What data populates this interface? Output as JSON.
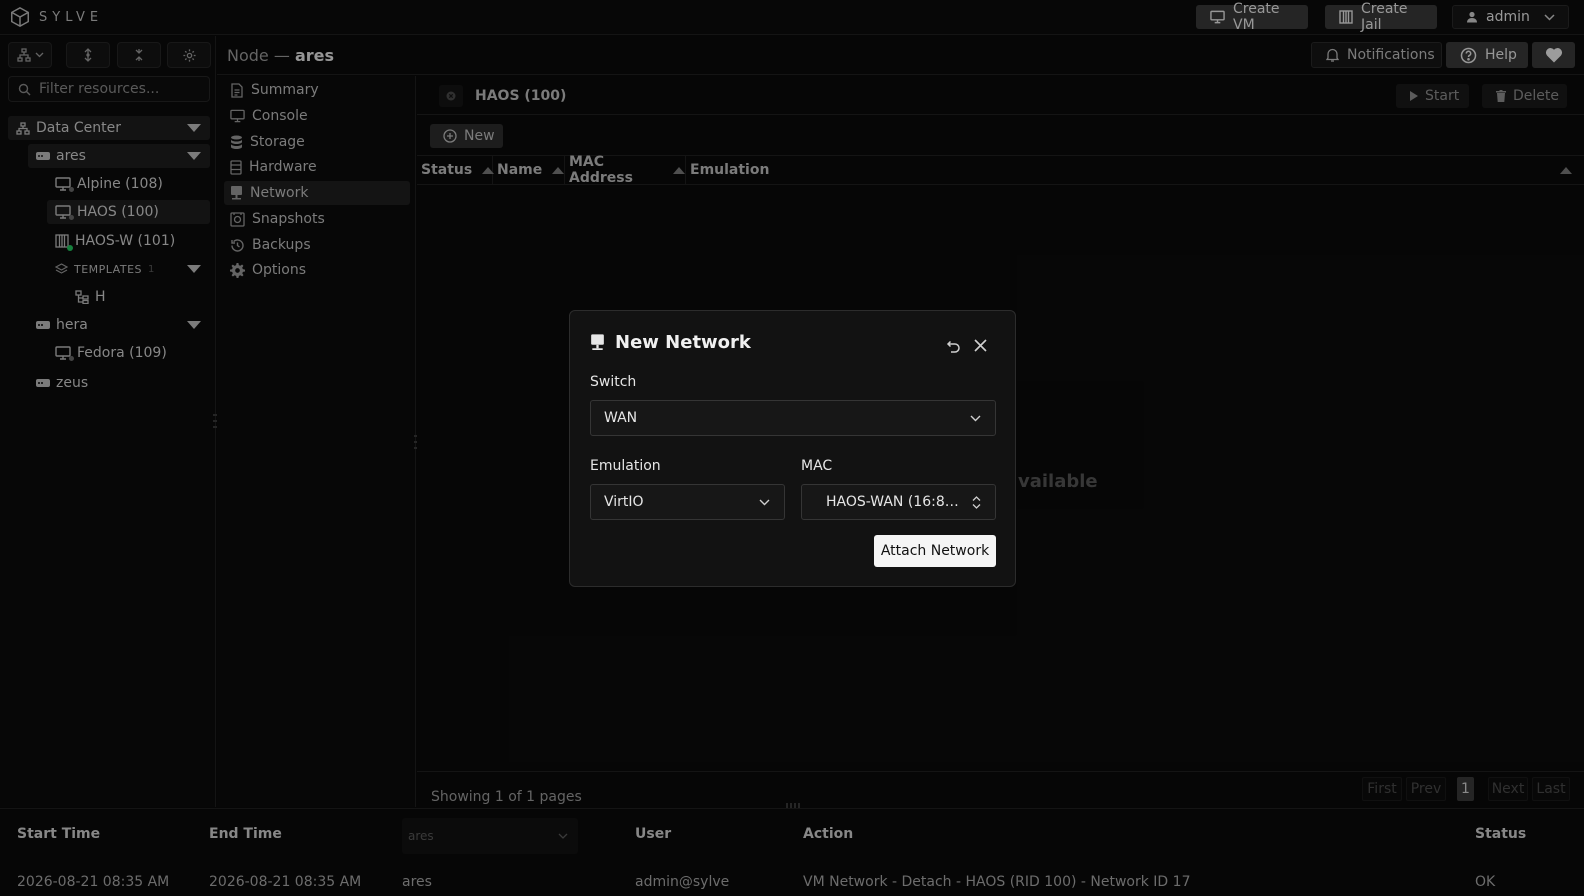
{
  "app": {
    "brand": "SYLVE"
  },
  "topbar": {
    "create_vm": "Create VM",
    "create_jail": "Create Jail",
    "user": "admin"
  },
  "header": {
    "node_prefix": "Node",
    "node_name": "ares",
    "notifications": "Notifications",
    "help": "Help"
  },
  "sidebar": {
    "filter_placeholder": "Filter resources...",
    "datacenter": "Data Center",
    "nodes": [
      {
        "label": "ares"
      },
      {
        "label": "hera"
      },
      {
        "label": "zeus"
      }
    ],
    "ares_items": [
      {
        "label": "Alpine (108)"
      },
      {
        "label": "HAOS (100)"
      },
      {
        "label": "HAOS-W (101)"
      }
    ],
    "templates_label": "TEMPLATES",
    "templates_count": "1",
    "template_item": "H",
    "hera_items": [
      {
        "label": "Fedora (109)"
      }
    ]
  },
  "menu": {
    "items": [
      {
        "label": "Summary",
        "icon": "file-icon"
      },
      {
        "label": "Console",
        "icon": "monitor-icon"
      },
      {
        "label": "Storage",
        "icon": "database-icon"
      },
      {
        "label": "Hardware",
        "icon": "server-icon"
      },
      {
        "label": "Network",
        "icon": "network-icon"
      },
      {
        "label": "Snapshots",
        "icon": "camera-icon"
      },
      {
        "label": "Backups",
        "icon": "history-icon"
      },
      {
        "label": "Options",
        "icon": "gear-icon"
      }
    ],
    "selected": "Network"
  },
  "content": {
    "tab_title": "HAOS (100)",
    "start": "Start",
    "delete": "Delete",
    "new": "New",
    "columns": [
      "Status",
      "Name",
      "MAC Address",
      "Emulation"
    ],
    "empty_text_visible": "vailable",
    "showing": "Showing 1 of 1 pages",
    "pagination": {
      "first": "First",
      "prev": "Prev",
      "page": "1",
      "next": "Next",
      "last": "Last"
    }
  },
  "log": {
    "headers": {
      "start_time": "Start Time",
      "end_time": "End Time",
      "user": "User",
      "action": "Action",
      "status": "Status"
    },
    "node_filter": "ares",
    "rows": [
      {
        "start": "2026-08-21 08:35 AM",
        "end": "2026-08-21 08:35 AM",
        "node": "ares",
        "user": "admin@sylve",
        "action": "VM Network - Detach - HAOS (RID 100) - Network ID 17",
        "status": "OK"
      }
    ]
  },
  "modal": {
    "title": "New Network",
    "switch_label": "Switch",
    "switch_value": "WAN",
    "emulation_label": "Emulation",
    "emulation_value": "VirtIO",
    "mac_label": "MAC",
    "mac_value": "HAOS-WAN (16:8…",
    "submit": "Attach Network"
  },
  "colors": {
    "accent": "#f5f5f5",
    "bg": "#0a0a0a",
    "panel": "#121212",
    "status_green": "#22c55e"
  }
}
